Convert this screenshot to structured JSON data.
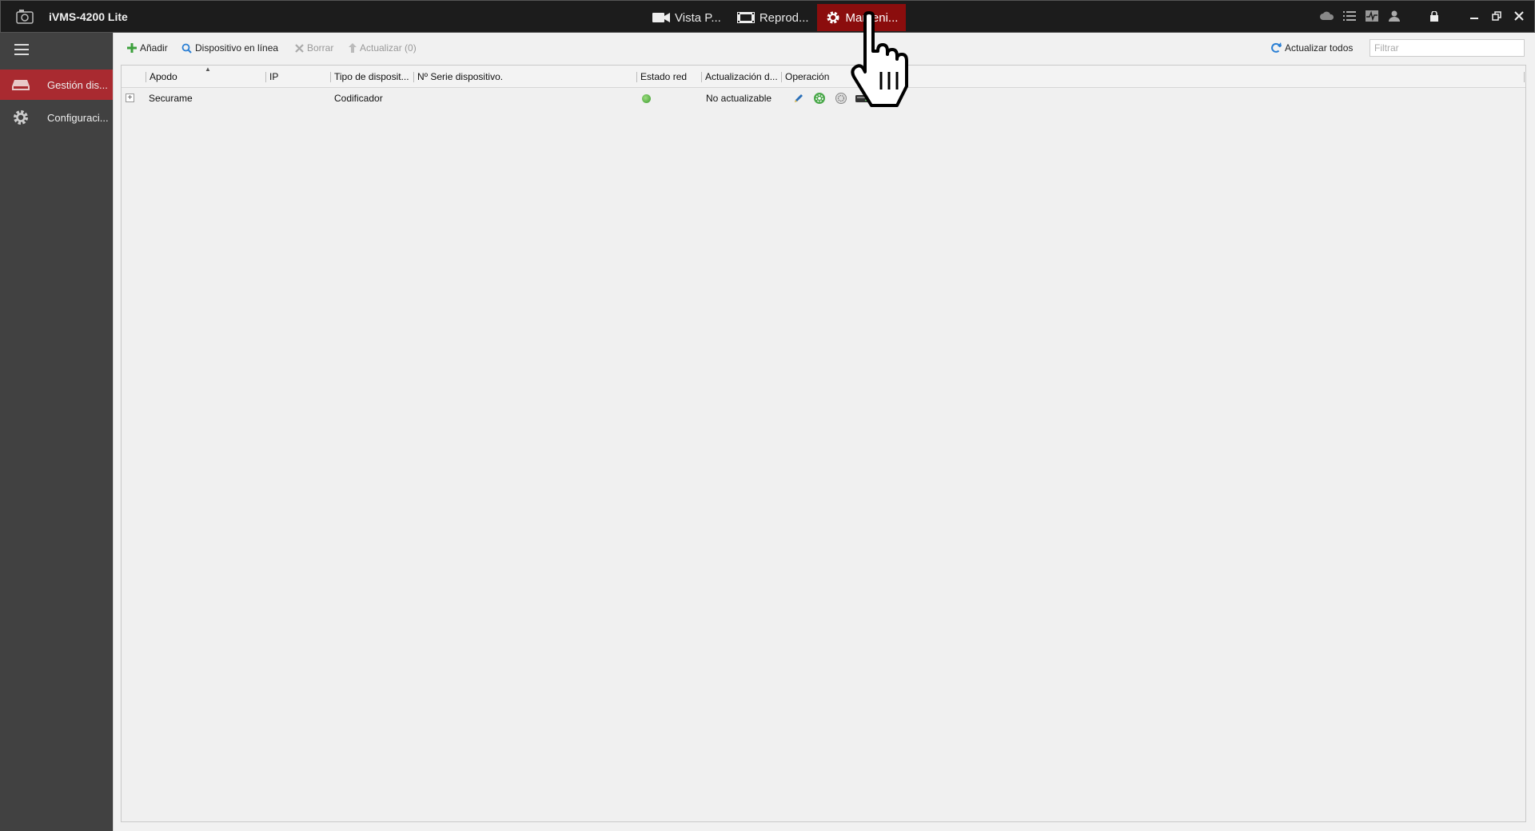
{
  "app": {
    "title": "iVMS-4200 Lite"
  },
  "modules": [
    {
      "label": "Vista P...",
      "icon": "video-camera-icon"
    },
    {
      "label": "Reprod...",
      "icon": "film-icon"
    },
    {
      "label": "Manteni...",
      "icon": "gear-icon",
      "active": true
    }
  ],
  "system_icons": [
    "cloud-icon",
    "list-icon",
    "activity-icon",
    "user-icon",
    "lock-icon",
    "minimize-icon",
    "restore-icon",
    "close-icon"
  ],
  "sidebar": {
    "items": [
      {
        "label": "Gestión dis...",
        "icon": "device-icon",
        "active": true
      },
      {
        "label": "Configuraci...",
        "icon": "gear-icon"
      }
    ]
  },
  "toolbar": {
    "add": "Añadir",
    "online_device": "Dispositivo en línea",
    "delete": "Borrar",
    "upgrade": "Actualizar (0)",
    "refresh_all": "Actualizar todos",
    "filter_placeholder": "Filtrar"
  },
  "table": {
    "columns": [
      "Apodo",
      "IP",
      "Tipo de disposit...",
      "Nº Serie dispositivo.",
      "Estado red",
      "Actualización d...",
      "Operación"
    ],
    "rows": [
      {
        "nickname": "Securame",
        "ip": "",
        "type": "Codificador",
        "serial": "",
        "network_status": "online",
        "upgrade_status": "No actualizable",
        "operations": [
          "edit-icon",
          "remote-config-icon",
          "device-status-icon",
          "storage-icon"
        ]
      }
    ]
  },
  "colors": {
    "accent_red": "#8b0d0d",
    "sidebar_active": "#a92a30",
    "online_green": "#3a9a2e"
  }
}
